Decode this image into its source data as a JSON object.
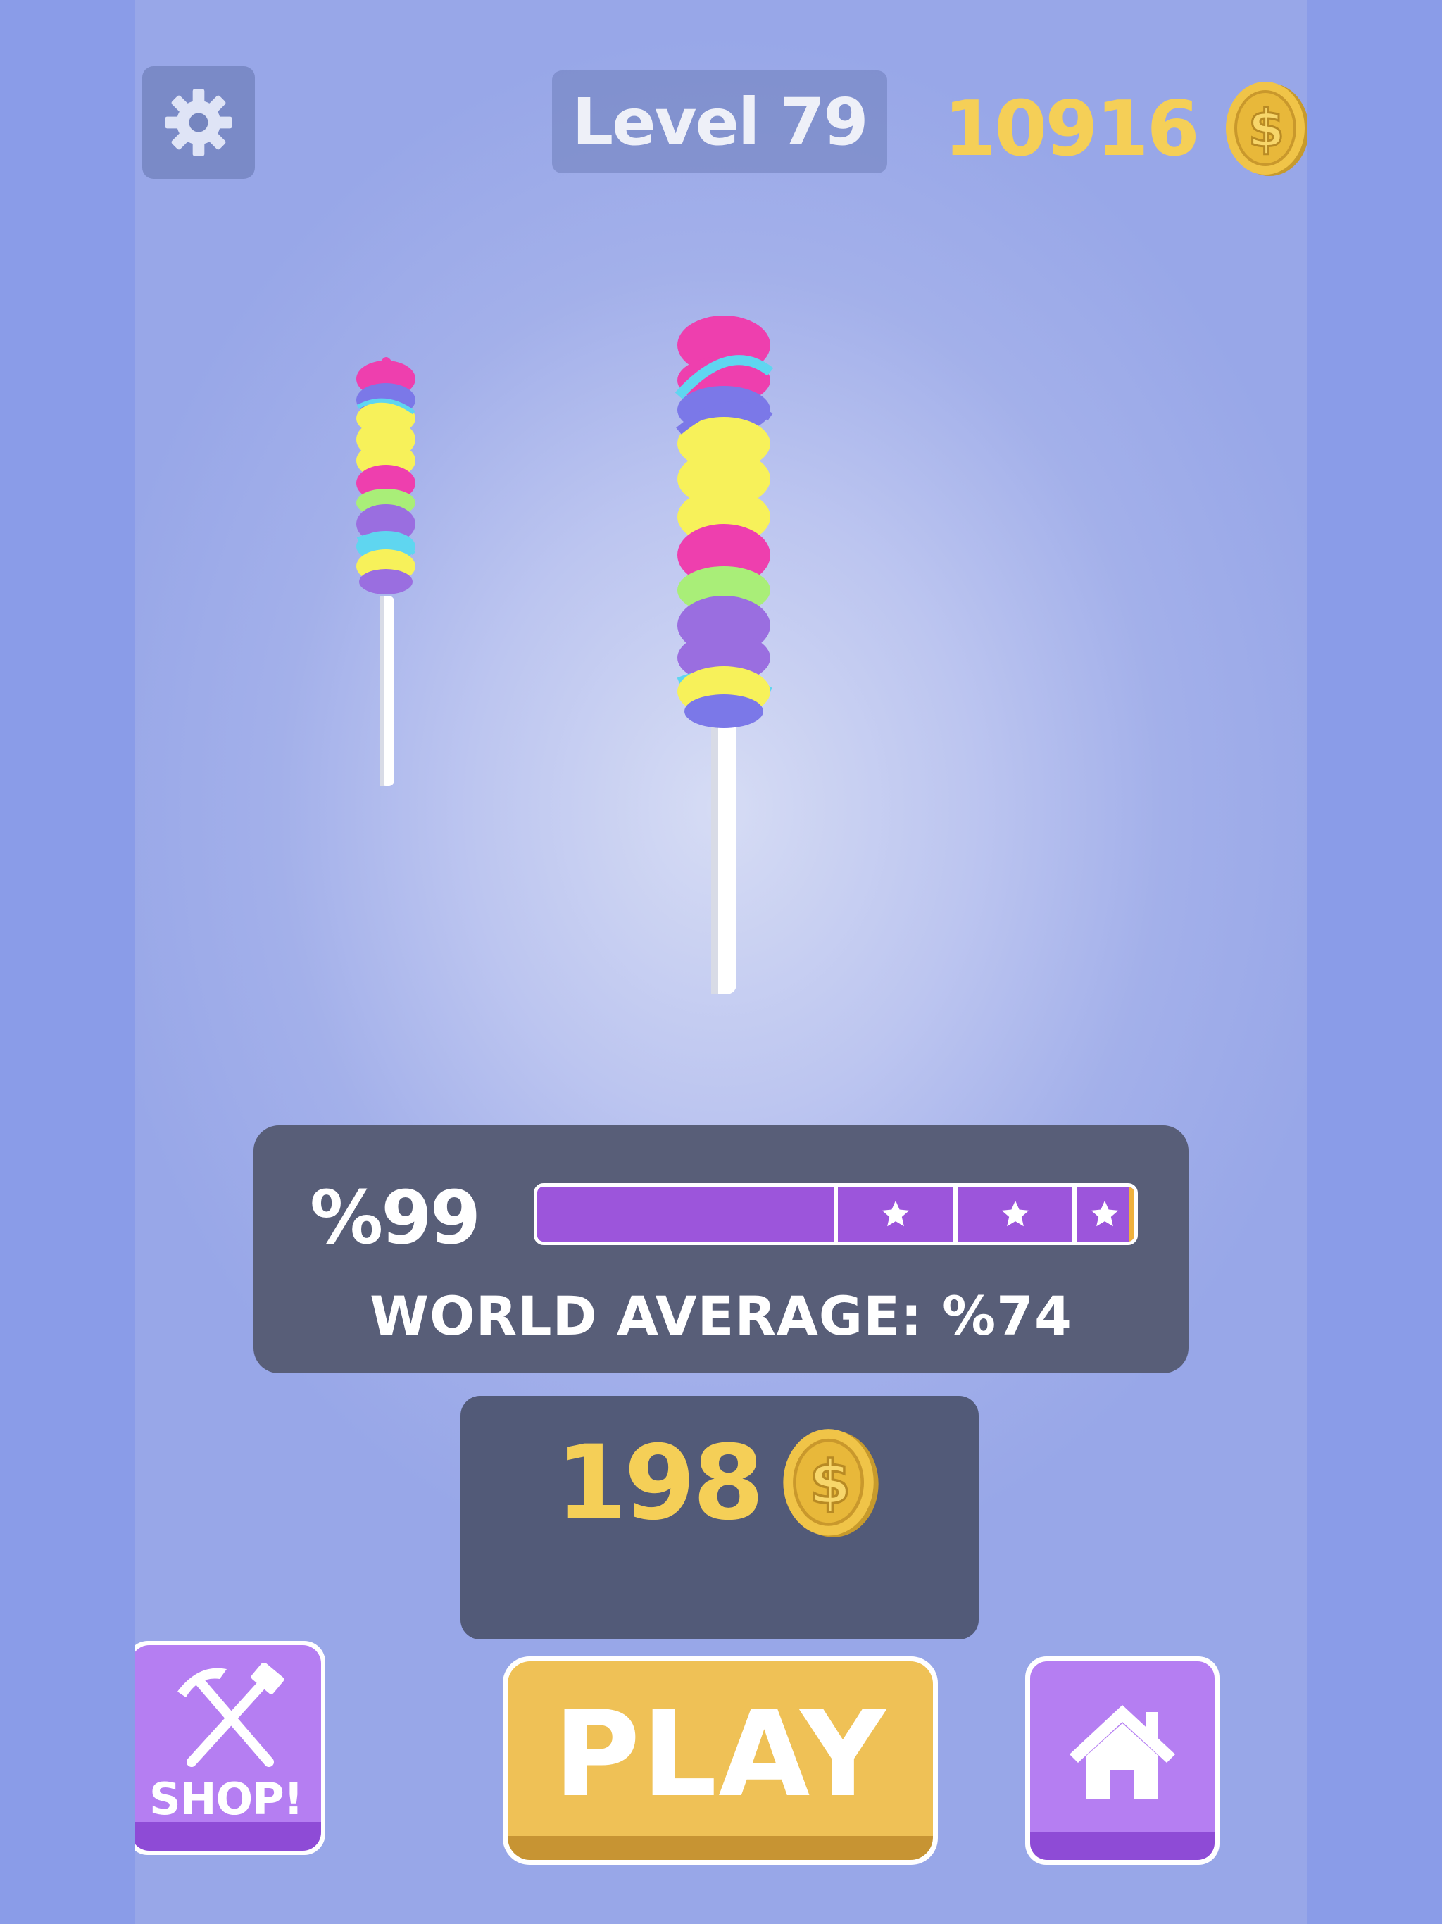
{
  "hud": {
    "settings_icon": "gear-icon",
    "level_label": "Level 79",
    "coin_total": "10916",
    "coin_icon": "coin-dollar-icon"
  },
  "scene": {
    "items": [
      "reference-lollipop",
      "player-lollipop"
    ],
    "stripe_colors": [
      "#ee3fae",
      "#f7f15a",
      "#9a6ee0",
      "#a9ee78",
      "#5fd6f0",
      "#7b78e8"
    ]
  },
  "result": {
    "percent_label": "%99",
    "percent_value": 99,
    "star_thresholds_percent": [
      50,
      70,
      90
    ],
    "world_average_label": "WORLD AVERAGE: %74",
    "reward_amount": "198"
  },
  "buttons": {
    "shop_label": "SHOP!",
    "play_label": "PLAY",
    "home_icon": "home-icon",
    "shop_icon": "hammer-pickaxe-icon"
  },
  "colors": {
    "accent_gold": "#f5cf57",
    "purple": "#9c55db",
    "button_purple": "#b57ef2",
    "button_gold": "#efc156",
    "panel": "#585e78"
  }
}
